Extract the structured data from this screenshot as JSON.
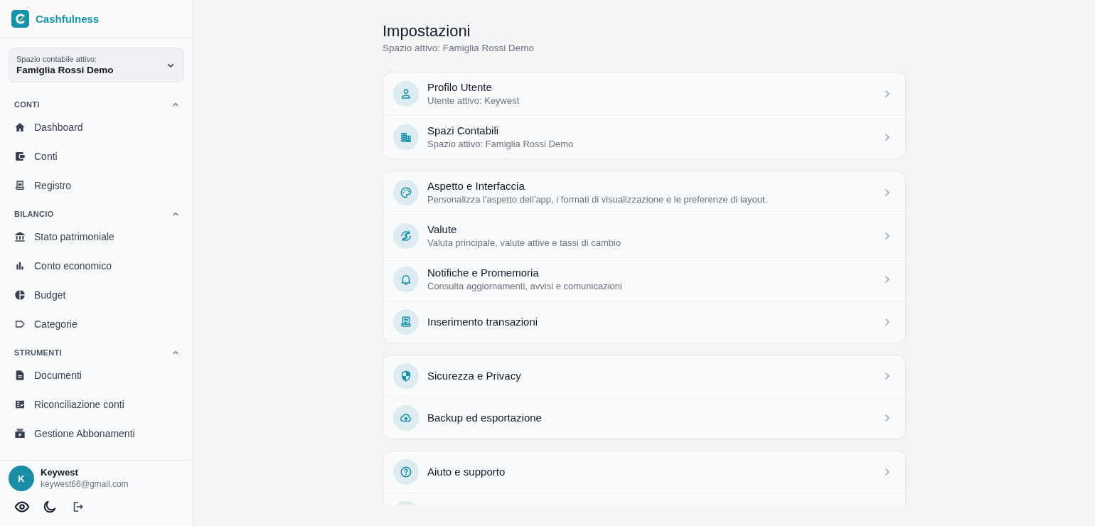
{
  "app": {
    "name": "Cashfulness"
  },
  "space_selector": {
    "label": "Spazio contabile attivo:",
    "value": "Famiglia Rossi Demo"
  },
  "sidebar": {
    "sections": [
      {
        "title": "CONTI",
        "expanded": true,
        "items": [
          {
            "label": "Dashboard",
            "selected": false
          },
          {
            "label": "Conti",
            "selected": false
          },
          {
            "label": "Registro",
            "selected": false
          }
        ]
      },
      {
        "title": "BILANCIO",
        "expanded": true,
        "items": [
          {
            "label": "Stato patrimoniale",
            "selected": false
          },
          {
            "label": "Conto economico",
            "selected": false
          },
          {
            "label": "Budget",
            "selected": false
          },
          {
            "label": "Categorie",
            "selected": false
          }
        ]
      },
      {
        "title": "STRUMENTI",
        "expanded": true,
        "items": [
          {
            "label": "Documenti",
            "selected": false
          },
          {
            "label": "Riconciliazione conti",
            "selected": false
          },
          {
            "label": "Gestione Abbonamenti",
            "selected": false
          }
        ]
      }
    ]
  },
  "user": {
    "initial": "K",
    "name": "Keywest",
    "email": "keywest66@gmail.com"
  },
  "page": {
    "title": "Impostazioni",
    "subtitle": "Spazio attivo: Famiglia Rossi Demo"
  },
  "settings_groups": [
    {
      "items": [
        {
          "title": "Profilo Utente",
          "description": "Utente attivo: Keywest"
        },
        {
          "title": "Spazi Contabili",
          "description": "Spazio attivo: Famiglia Rossi Demo"
        }
      ]
    },
    {
      "items": [
        {
          "title": "Aspetto e Interfaccia",
          "description": "Personalizza l'aspetto dell'app, i formati di visualizzazione e le preferenze di layout."
        },
        {
          "title": "Valute",
          "description": "Valuta principale, valute attive e tassi di cambio"
        },
        {
          "title": "Notifiche e Promemoria",
          "description": "Consulta aggiornamenti, avvisi e comunicazioni"
        },
        {
          "title": "Inserimento transazioni"
        }
      ]
    },
    {
      "items": [
        {
          "title": "Sicurezza e Privacy"
        },
        {
          "title": "Backup ed esportazione"
        }
      ]
    },
    {
      "items": [
        {
          "title": "Aiuto e supporto"
        }
      ]
    }
  ]
}
